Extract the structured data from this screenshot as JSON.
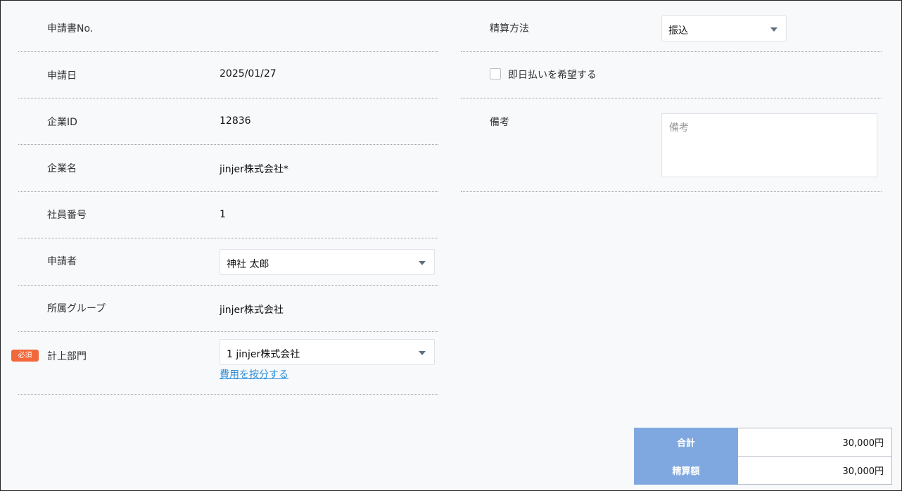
{
  "left_form": {
    "application_no_label": "申請書No.",
    "application_no_value": "",
    "application_date_label": "申請日",
    "application_date_value": "2025/01/27",
    "company_id_label": "企業ID",
    "company_id_value": "12836",
    "company_name_label": "企業名",
    "company_name_value": "jinjer株式会社*",
    "employee_no_label": "社員番号",
    "employee_no_value": "1",
    "applicant_label": "申請者",
    "applicant_value": "神社 太郎",
    "group_label": "所属グループ",
    "group_value": "jinjer株式会社",
    "required_badge": "必須",
    "department_label": "計上部門",
    "department_value": "1 jinjer株式会社",
    "allocate_link": "費用を按分する"
  },
  "right_form": {
    "settlement_method_label": "精算方法",
    "settlement_method_value": "振込",
    "same_day_label": "即日払いを希望する",
    "same_day_checked": false,
    "remarks_label": "備考",
    "remarks_placeholder": "備考",
    "remarks_value": ""
  },
  "totals": {
    "total_label": "合計",
    "total_value": "30,000円",
    "settlement_amount_label": "精算額",
    "settlement_amount_value": "30,000円"
  },
  "colors": {
    "accent_blue": "#7fa8e0",
    "required_orange": "#f2683a",
    "link_blue": "#2f8fd8"
  },
  "icons": {
    "dropdown": "chevron-down-icon",
    "checkbox": "checkbox-icon"
  }
}
